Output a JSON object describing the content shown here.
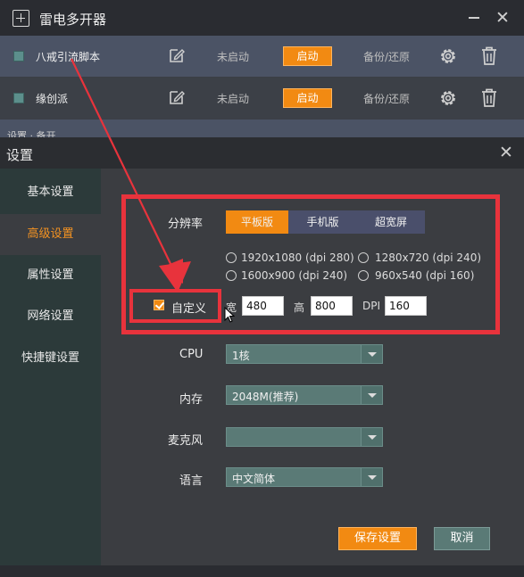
{
  "main_window": {
    "title": "雷电多开器",
    "instances": [
      {
        "name": "八戒引流脚本",
        "status": "未启动",
        "launch_label": "启动",
        "backup_label": "备份/还原"
      },
      {
        "name": "缘创派",
        "status": "未启动",
        "launch_label": "启动",
        "backup_label": "备份/还原"
      }
    ],
    "peek_text": "设置 · 备开"
  },
  "dialog": {
    "title": "设置",
    "sidebar": [
      {
        "label": "基本设置",
        "active": false
      },
      {
        "label": "高级设置",
        "active": true
      },
      {
        "label": "属性设置",
        "active": false
      },
      {
        "label": "网络设置",
        "active": false
      },
      {
        "label": "快捷键设置",
        "active": false
      }
    ],
    "resolution": {
      "label": "分辨率",
      "tabs": [
        {
          "label": "平板版",
          "active": true
        },
        {
          "label": "手机版",
          "active": false
        },
        {
          "label": "超宽屏",
          "active": false
        }
      ],
      "presets": [
        "1920x1080 (dpi 280)",
        "1280x720 (dpi 240)",
        "1600x900 (dpi 240)",
        "960x540 (dpi 160)"
      ],
      "custom_label": "自定义",
      "custom_checked": true,
      "width_label": "宽",
      "width_value": "480",
      "height_label": "高",
      "height_value": "800",
      "dpi_label": "DPI",
      "dpi_value": "160"
    },
    "cpu": {
      "label": "CPU",
      "value": "1核"
    },
    "memory": {
      "label": "内存",
      "value": "2048M(推荐)"
    },
    "microphone": {
      "label": "麦克风",
      "value": ""
    },
    "language": {
      "label": "语言",
      "value": "中文简体"
    },
    "save_label": "保存设置",
    "cancel_label": "取消"
  },
  "colors": {
    "accent": "#f28a12",
    "annotation": "#e8333c",
    "select_bg": "#5a7a76"
  }
}
